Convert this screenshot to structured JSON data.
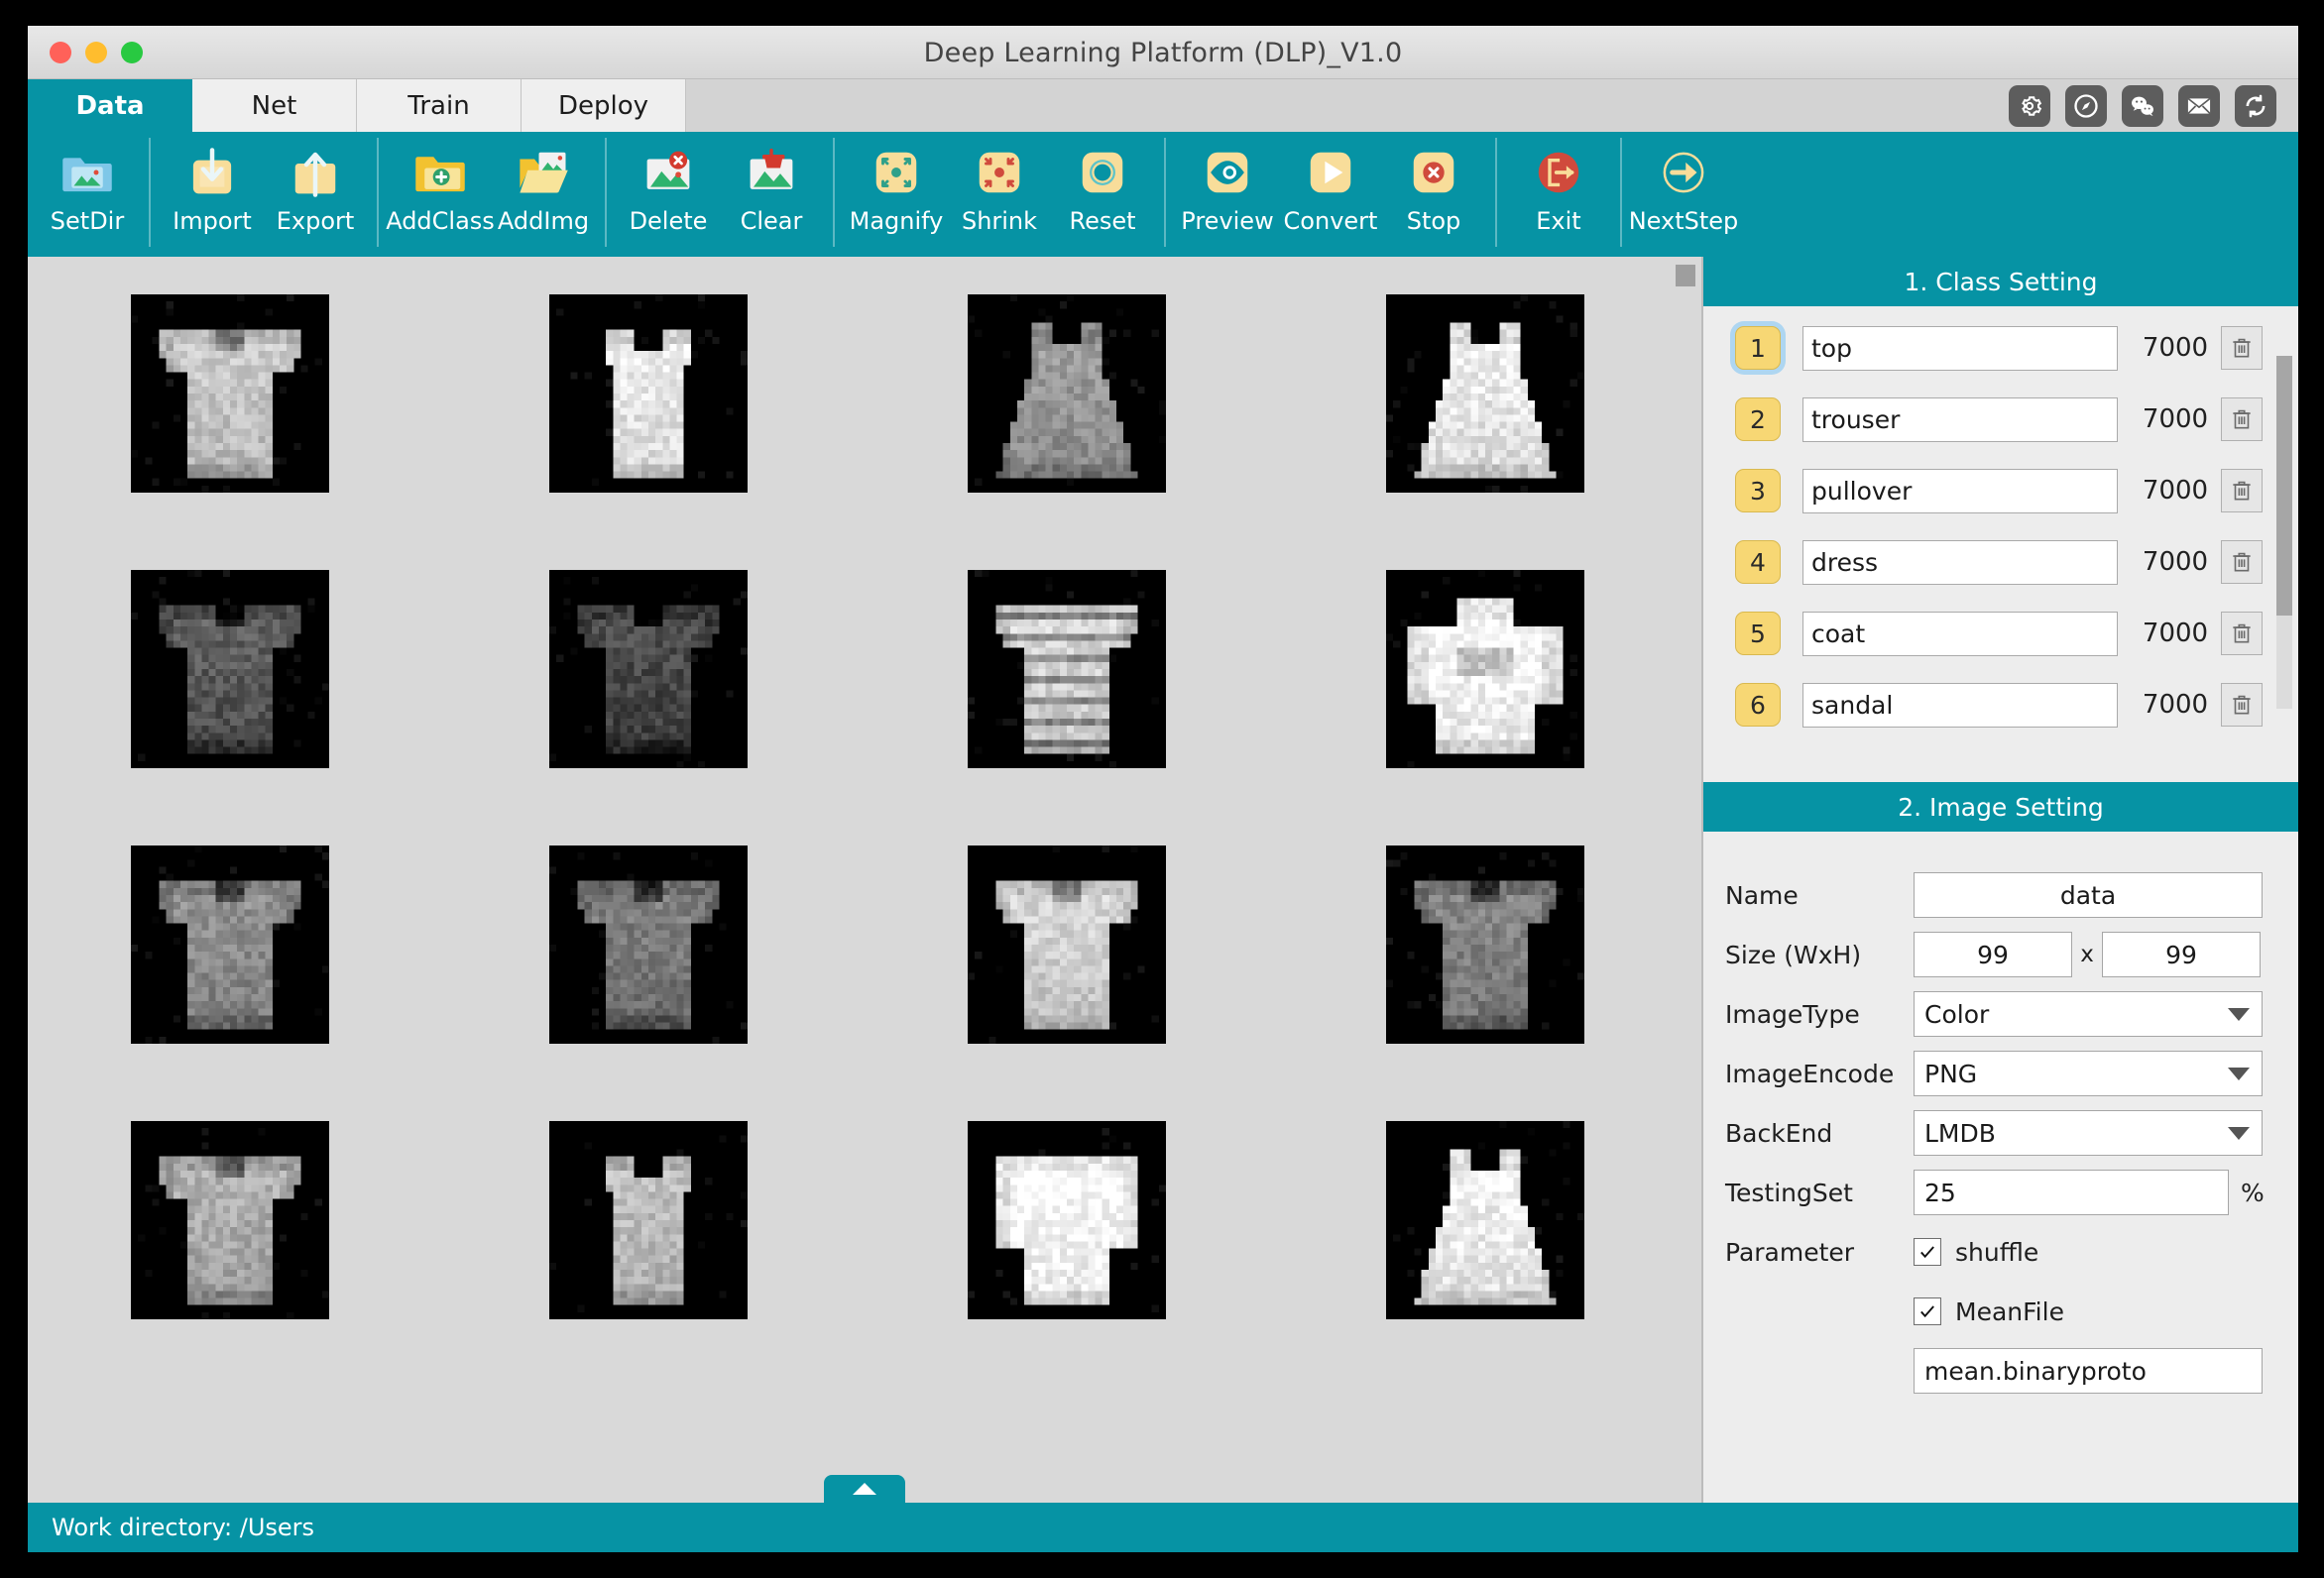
{
  "window": {
    "title": "Deep Learning Platform (DLP)_V1.0",
    "traffic_lights": [
      "close",
      "minimize",
      "zoom"
    ],
    "accent_color": "#0693a4",
    "badge_color": "#f7d774"
  },
  "tabs": [
    {
      "label": "Data",
      "active": true
    },
    {
      "label": "Net",
      "active": false
    },
    {
      "label": "Train",
      "active": false
    },
    {
      "label": "Deploy",
      "active": false
    }
  ],
  "header_icons": [
    {
      "name": "gear-icon",
      "glyph": "gear"
    },
    {
      "name": "compass-icon",
      "glyph": "compass"
    },
    {
      "name": "wechat-icon",
      "glyph": "wechat"
    },
    {
      "name": "mail-icon",
      "glyph": "mail"
    },
    {
      "name": "refresh-icon",
      "glyph": "refresh"
    }
  ],
  "toolbar": {
    "groups": [
      {
        "buttons": [
          {
            "label": "SetDir",
            "icon": "folder-image-icon"
          }
        ]
      },
      {
        "buttons": [
          {
            "label": "Import",
            "icon": "import-icon"
          },
          {
            "label": "Export",
            "icon": "export-icon"
          }
        ]
      },
      {
        "buttons": [
          {
            "label": "AddClass",
            "icon": "folder-plus-icon"
          },
          {
            "label": "AddImg",
            "icon": "folder-open-image-icon"
          }
        ]
      },
      {
        "buttons": [
          {
            "label": "Delete",
            "icon": "image-delete-icon"
          },
          {
            "label": "Clear",
            "icon": "image-clear-icon"
          }
        ]
      },
      {
        "buttons": [
          {
            "label": "Magnify",
            "icon": "magnify-icon"
          },
          {
            "label": "Shrink",
            "icon": "shrink-icon"
          },
          {
            "label": "Reset",
            "icon": "reset-icon"
          }
        ]
      },
      {
        "buttons": [
          {
            "label": "Preview",
            "icon": "eye-icon"
          },
          {
            "label": "Convert",
            "icon": "play-icon"
          },
          {
            "label": "Stop",
            "icon": "stop-icon"
          }
        ]
      },
      {
        "buttons": [
          {
            "label": "Exit",
            "icon": "exit-icon"
          }
        ]
      },
      {
        "buttons": [
          {
            "label": "NextStep",
            "icon": "arrow-right-circle-icon"
          }
        ]
      }
    ]
  },
  "grid": {
    "rows": 4,
    "cols": 4,
    "thumbnails": [
      {
        "kind": "tshirt",
        "tone": 196
      },
      {
        "kind": "tank",
        "tone": 228
      },
      {
        "kind": "dressdk",
        "tone": 150
      },
      {
        "kind": "dress",
        "tone": 232
      },
      {
        "kind": "tshirtdk",
        "tone": 88
      },
      {
        "kind": "tshirtdk",
        "tone": 72
      },
      {
        "kind": "striped",
        "tone": 210
      },
      {
        "kind": "hoodie",
        "tone": 244
      },
      {
        "kind": "tshirt",
        "tone": 138
      },
      {
        "kind": "tshirt",
        "tone": 120
      },
      {
        "kind": "tshirt",
        "tone": 206
      },
      {
        "kind": "tshirt",
        "tone": 128
      },
      {
        "kind": "tshirt",
        "tone": 170
      },
      {
        "kind": "tank",
        "tone": 186
      },
      {
        "kind": "longslv",
        "tone": 246
      },
      {
        "kind": "dress",
        "tone": 236
      }
    ]
  },
  "class_setting": {
    "title": "1. Class Setting",
    "delete_icon": "trash-icon",
    "selected_index": 0,
    "classes": [
      {
        "index": "1",
        "name": "top",
        "count": "7000"
      },
      {
        "index": "2",
        "name": "trouser",
        "count": "7000"
      },
      {
        "index": "3",
        "name": "pullover",
        "count": "7000"
      },
      {
        "index": "4",
        "name": "dress",
        "count": "7000"
      },
      {
        "index": "5",
        "name": "coat",
        "count": "7000"
      },
      {
        "index": "6",
        "name": "sandal",
        "count": "7000"
      }
    ]
  },
  "image_setting": {
    "title": "2. Image Setting",
    "name_label": "Name",
    "name_value": "data",
    "size_label": "Size (WxH)",
    "size_width": "99",
    "size_sep": "x",
    "size_height": "99",
    "imagetype_label": "ImageType",
    "imagetype_value": "Color",
    "imageencode_label": "ImageEncode",
    "imageencode_value": "PNG",
    "backend_label": "BackEnd",
    "backend_value": "LMDB",
    "testingset_label": "TestingSet",
    "testingset_value": "25",
    "percent_sign": "%",
    "parameter_label": "Parameter",
    "shuffle_label": "shuffle",
    "shuffle_checked": true,
    "meanfile_label": "MeanFile",
    "meanfile_checked": true,
    "meanfile_value": "mean.binaryproto"
  },
  "statusbar": {
    "text": "Work directory:  /Users"
  }
}
